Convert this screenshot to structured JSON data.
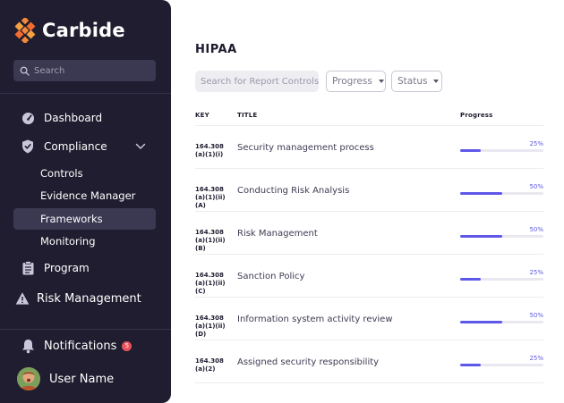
{
  "app": {
    "name": "Carbide"
  },
  "sidebar": {
    "search_placeholder": "Search",
    "nav": {
      "dashboard": "Dashboard",
      "compliance": "Compliance",
      "program": "Program",
      "risk_management": "Risk Management"
    },
    "compliance_sub": [
      {
        "label": "Controls",
        "active": false
      },
      {
        "label": "Evidence Manager",
        "active": false
      },
      {
        "label": "Frameworks",
        "active": true
      },
      {
        "label": "Monitoring",
        "active": false
      }
    ],
    "notifications": {
      "label": "Notifications",
      "count": "5"
    },
    "user": {
      "name": "User Name"
    }
  },
  "main": {
    "title": "HIPAA",
    "search_placeholder": "Search for Report Controls",
    "filters": {
      "progress": "Progress",
      "status": "Status"
    },
    "columns": {
      "key": "KEY",
      "title": "TITLE",
      "progress": "Progress"
    },
    "rows": [
      {
        "key_line1": "164.308",
        "key_line2": "(a)(1)(i)",
        "title": "Security management process",
        "progress_label": "25%",
        "progress": 0.25
      },
      {
        "key_line1": "164.308",
        "key_line2": "(a)(1)(ii)(A)",
        "title": "Conducting Risk Analysis",
        "progress_label": "50%",
        "progress": 0.5
      },
      {
        "key_line1": "164.308",
        "key_line2": "(a)(1)(ii)(B)",
        "title": "Risk Management",
        "progress_label": "50%",
        "progress": 0.5
      },
      {
        "key_line1": "164.308",
        "key_line2": "(a)(1)(ii)(C)",
        "title": "Sanction Policy",
        "progress_label": "25%",
        "progress": 0.25
      },
      {
        "key_line1": "164.308",
        "key_line2": "(a)(1)(ii)(D)",
        "title": "Information system activity review",
        "progress_label": "50%",
        "progress": 0.5
      },
      {
        "key_line1": "164.308",
        "key_line2": "(a)(2)",
        "title": "Assigned security responsibility",
        "progress_label": "25%",
        "progress": 0.25
      }
    ]
  },
  "colors": {
    "sidebar_bg": "#1f1d2f",
    "brand_orange": "#f5883a",
    "accent": "#5e58e8",
    "badge": "#e9525b"
  }
}
